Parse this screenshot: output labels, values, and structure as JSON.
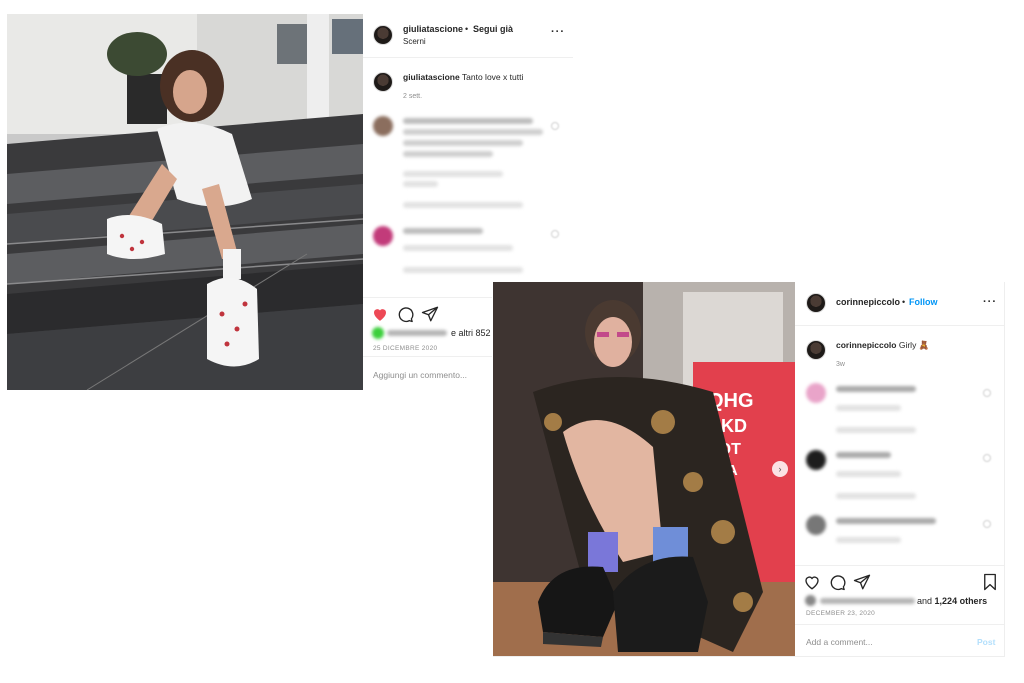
{
  "post1": {
    "username": "giuliatascione",
    "follow_label": "Segui già",
    "location": "Scerni",
    "caption_user": "giuliatascione",
    "caption_text": "Tanto love x tutti",
    "caption_time": "2 sett.",
    "likes_suffix": "e altri 852",
    "date": "25 DICEMBRE 2020",
    "add_comment_placeholder": "Aggiungi un commento..."
  },
  "post2": {
    "username": "corinnepiccolo",
    "follow_label": "Follow",
    "caption_user": "corinnepiccolo",
    "caption_text": "Girly 🧸",
    "caption_time": "3w",
    "likes_and": "and",
    "likes_count": "1,224 others",
    "date": "DECEMBER 23, 2020",
    "add_comment_placeholder": "Add a comment...",
    "post_button": "Post"
  },
  "colors": {
    "follow_blue": "#0095f6",
    "like_red": "#ed4956",
    "post_disabled": "#b2dffc"
  }
}
